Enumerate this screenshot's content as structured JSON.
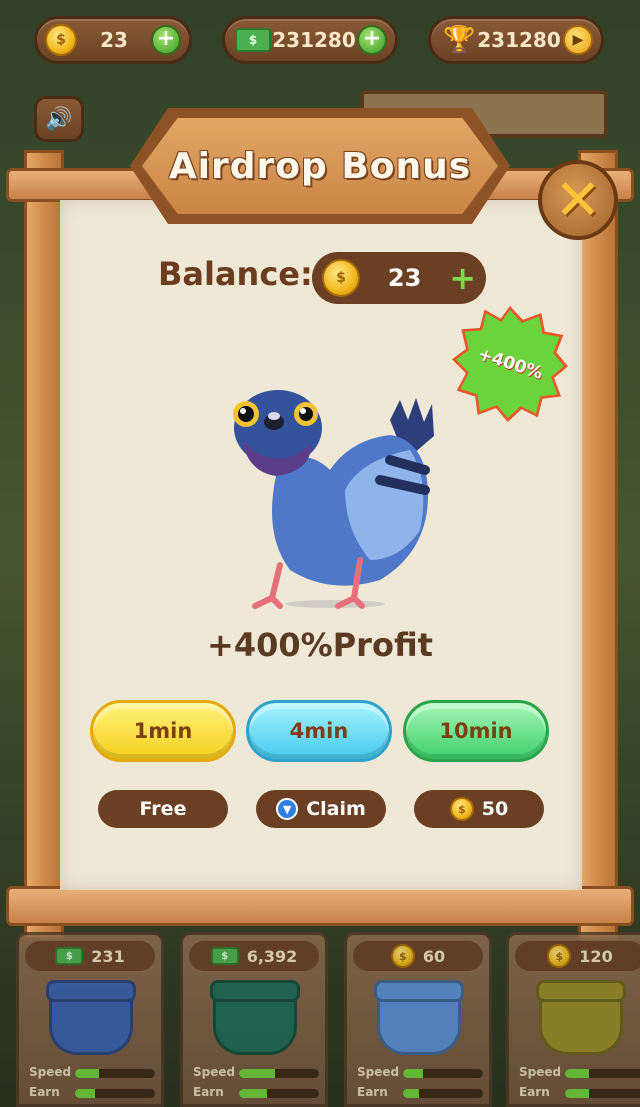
{
  "top_bar": {
    "coins": "23",
    "cash": "231280",
    "trophies": "231280"
  },
  "popup": {
    "title": "Airdrop Bonus",
    "balance_label": "Balance:",
    "balance_value": "23",
    "badge": "+400%",
    "profit_text": "+400%Profit",
    "time_options": [
      {
        "label": "1min",
        "cost": "Free"
      },
      {
        "label": "4min",
        "cost": "Claim"
      },
      {
        "label": "10min",
        "cost": "50"
      }
    ]
  },
  "shop": {
    "cards": [
      {
        "price": "231",
        "currency": "cash",
        "pot_color": "#3a5fb0",
        "speed_label": "Speed",
        "earn_label": "Earn",
        "speed": 0.3,
        "earn": 0.25
      },
      {
        "price": "6,392",
        "currency": "cash",
        "pot_color": "#1f6a55",
        "speed_label": "Speed",
        "earn_label": "Earn",
        "speed": 0.45,
        "earn": 0.35
      },
      {
        "price": "60",
        "currency": "coin",
        "pot_color": "#5a8ed6",
        "speed_label": "Speed",
        "earn_label": "Earn",
        "speed": 0.25,
        "earn": 0.2
      },
      {
        "price": "120",
        "currency": "coin",
        "pot_color": "#9a8a2a",
        "speed_label": "Speed",
        "earn_label": "Earn",
        "speed": 0.3,
        "earn": 0.3
      }
    ]
  },
  "icons": {
    "coin_symbol": "$",
    "ton_symbol": "▼"
  }
}
